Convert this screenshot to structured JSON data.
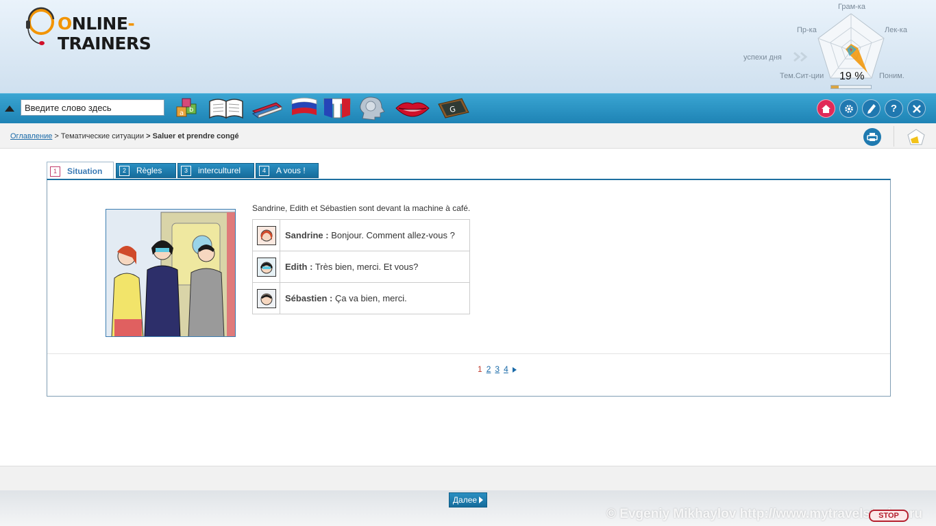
{
  "app": {
    "logo_text_first": "O",
    "logo_text_rest": "NLINE",
    "logo_text_dash": "-",
    "logo_text_end": "TRAINERS"
  },
  "radar": {
    "labels": {
      "top": "Грам-ка",
      "upper_left": "Пр-ка",
      "upper_right": "Лек-ка",
      "left": "успехи дня",
      "lower_left": "Тем.Сит-ции",
      "lower_right": "Поним."
    },
    "percent_text": "19 %",
    "progress_fraction": 0.19
  },
  "toolbar": {
    "search_placeholder": "Введите слово здесь",
    "tool_icons": [
      "alphabet-blocks-icon",
      "open-book-icon",
      "books-icon",
      "russian-flag-icon",
      "french-flag-icon",
      "head-brain-icon",
      "lips-icon",
      "chalkboard-icon"
    ],
    "right_buttons": [
      {
        "name": "home-icon",
        "color": "#e02a58"
      },
      {
        "name": "settings-icon",
        "color": "#1f78b0"
      },
      {
        "name": "pen-icon",
        "color": "#1f78b0"
      },
      {
        "name": "help-icon",
        "color": "#1f78b0"
      },
      {
        "name": "close-icon",
        "color": "#1f78b0"
      }
    ]
  },
  "breadcrumb": {
    "root": "Оглавление",
    "sep1": " > ",
    "middle": "Тематические ситуации",
    "sep2": " > ",
    "current": "Saluer et prendre congé"
  },
  "tabs": [
    {
      "num": "1",
      "label": "Situation",
      "active": true
    },
    {
      "num": "2",
      "label": "Règles",
      "active": false
    },
    {
      "num": "3",
      "label": "interculturel",
      "active": false
    },
    {
      "num": "4",
      "label": "A vous !",
      "active": false
    }
  ],
  "content": {
    "intro": "Sandrine, Edith et Sébastien sont devant la machine à café.",
    "dialog": [
      {
        "speaker": "Sandrine :",
        "line": " Bonjour. Comment allez-vous ?"
      },
      {
        "speaker": "Edith :",
        "line": " Très bien, merci. Et vous?"
      },
      {
        "speaker": "Sébastien :",
        "line": " Ça va bien, merci."
      }
    ]
  },
  "pager": {
    "current": "1",
    "pages": [
      "2",
      "3",
      "4"
    ]
  },
  "footer": {
    "next_label": "Далее",
    "watermark": "© Evgeniy Mikhaylov http://www.mytravelstories.ru",
    "stop_label": "STOP"
  },
  "colors": {
    "brand_blue": "#1e83b5",
    "logo_orange": "#f29400",
    "accent_red": "#c03a6b"
  }
}
